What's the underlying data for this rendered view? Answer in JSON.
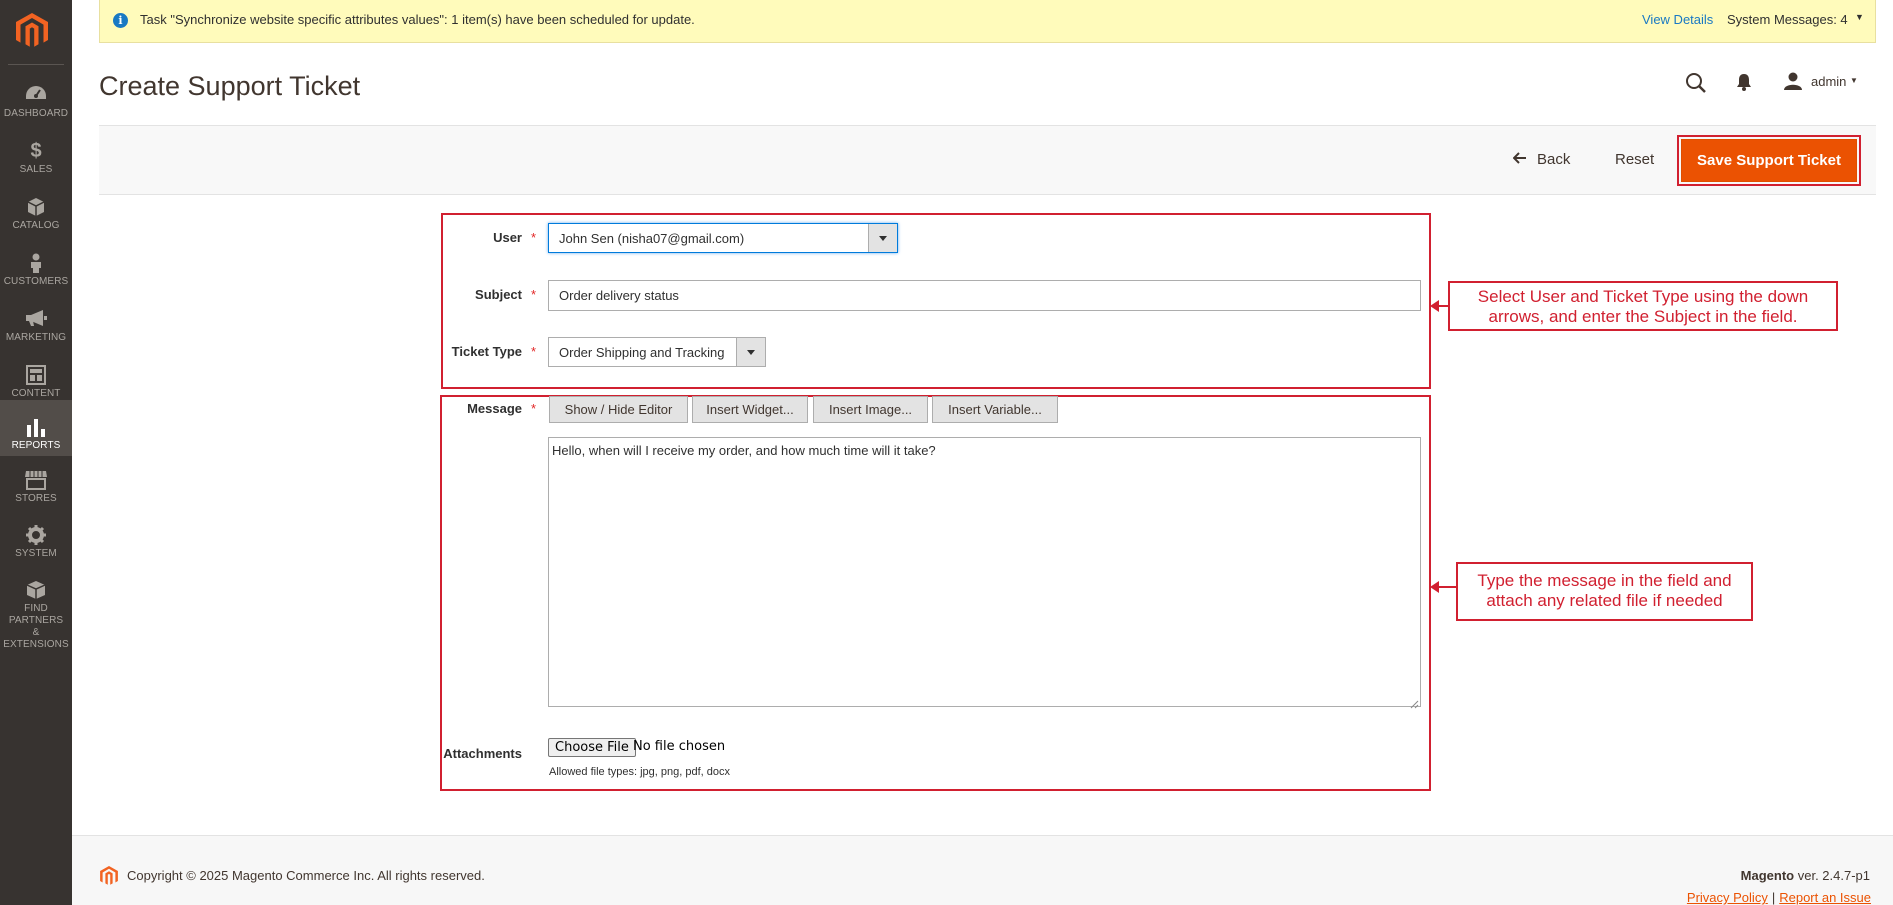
{
  "sidebar": {
    "items": [
      {
        "label": "DASHBOARD"
      },
      {
        "label": "SALES"
      },
      {
        "label": "CATALOG"
      },
      {
        "label": "CUSTOMERS"
      },
      {
        "label": "MARKETING"
      },
      {
        "label": "CONTENT"
      },
      {
        "label": "REPORTS"
      },
      {
        "label": "STORES"
      },
      {
        "label": "SYSTEM"
      },
      {
        "label": "FIND PARTNERS",
        "label2": "& EXTENSIONS"
      }
    ],
    "active": "REPORTS"
  },
  "notice": {
    "message": "Task \"Synchronize website specific attributes values\": 1 item(s) have been scheduled for update.",
    "view_details": "View Details",
    "system_messages": "System Messages: 4"
  },
  "header": {
    "title": "Create Support Ticket",
    "user": "admin"
  },
  "actions": {
    "back": "Back",
    "reset": "Reset",
    "save": "Save Support Ticket"
  },
  "form": {
    "user_label": "User",
    "user_value": "John Sen (nisha07@gmail.com)",
    "subject_label": "Subject",
    "subject_value": "Order delivery status",
    "type_label": "Ticket Type",
    "type_value": "Order Shipping and Tracking",
    "message_label": "Message",
    "editor_buttons": [
      "Show / Hide Editor",
      "Insert Widget...",
      "Insert Image...",
      "Insert Variable..."
    ],
    "message_value": "Hello, when will I receive my order, and how much time will it take?",
    "attachments_label": "Attachments",
    "choose_file": "Choose File",
    "no_file": "No file chosen",
    "allowed_types": "Allowed file types: jpg, png, pdf, docx",
    "required_mark": "*"
  },
  "callouts": {
    "first_line1": "Select User and Ticket Type using the down",
    "first_line2": "arrows, and enter the Subject in the field.",
    "second_line1": "Type the message in the field and",
    "second_line2": "attach any related file if needed"
  },
  "footer": {
    "copyright": "Copyright © 2025 Magento Commerce Inc. All rights reserved.",
    "brand": "Magento",
    "version": " ver. 2.4.7-p1",
    "privacy": "Privacy Policy",
    "separator": "|",
    "report": "Report an Issue"
  },
  "colors": {
    "sidebar_bg": "#373330",
    "accent": "#eb5202",
    "annotation": "#d12030",
    "link": "#1979c3"
  }
}
